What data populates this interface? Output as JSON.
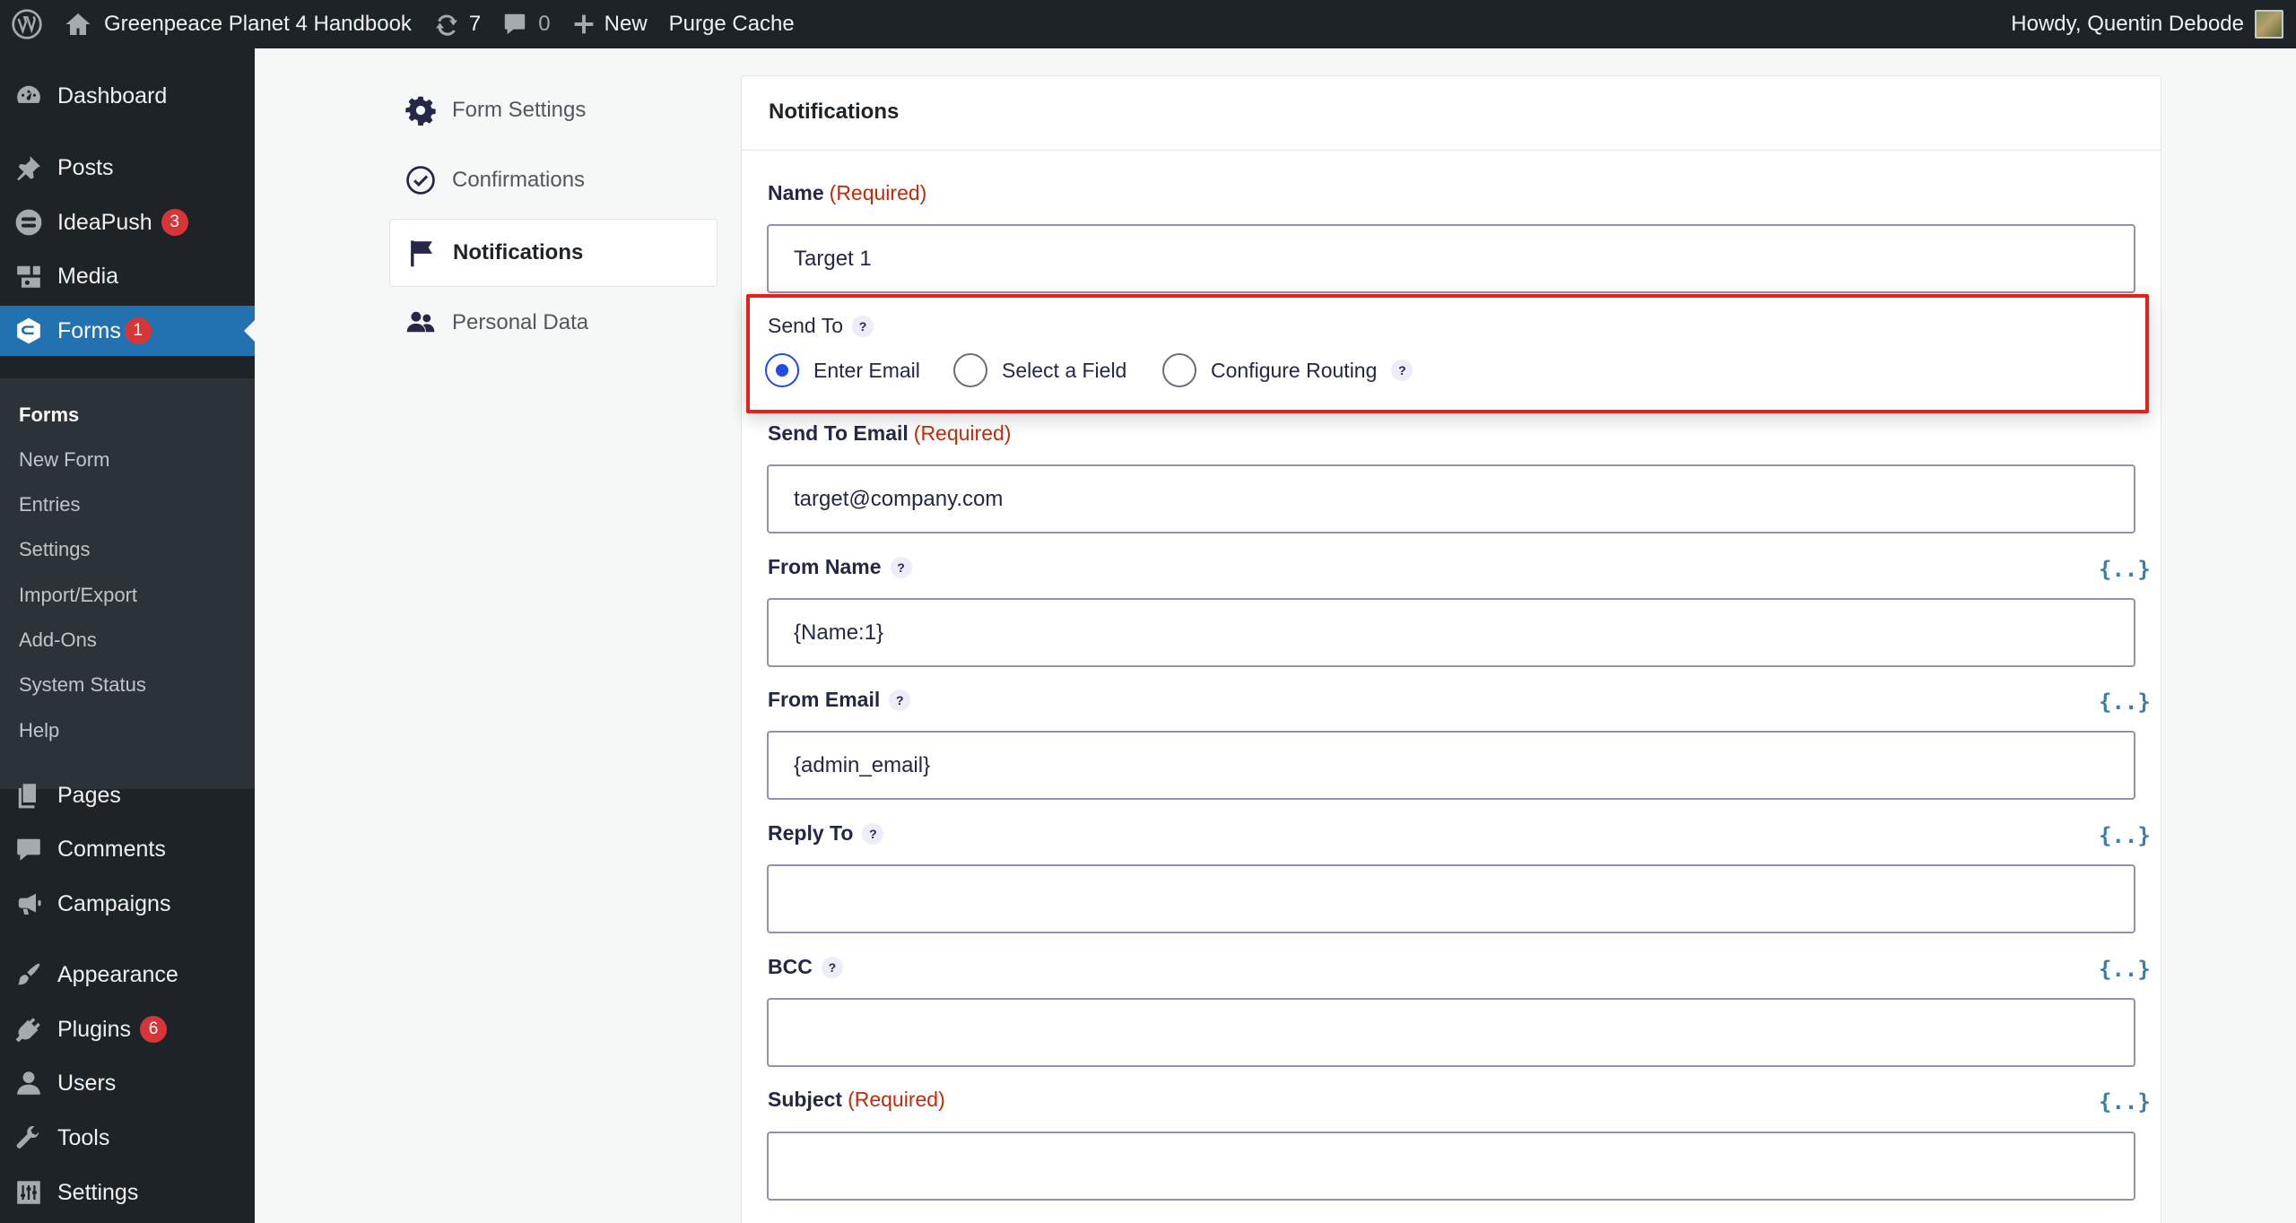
{
  "adminbar": {
    "site_name": "Greenpeace Planet 4 Handbook",
    "updates_count": "7",
    "comments_count": "0",
    "new_label": "New",
    "purge_label": "Purge Cache",
    "greeting": "Howdy, Quentin Debode"
  },
  "sidebar": {
    "items": {
      "dashboard": "Dashboard",
      "posts": "Posts",
      "ideapush": "IdeaPush",
      "ideapush_badge": "3",
      "media": "Media",
      "forms": "Forms",
      "forms_badge": "1",
      "pages": "Pages",
      "comments": "Comments",
      "campaigns": "Campaigns",
      "appearance": "Appearance",
      "plugins": "Plugins",
      "plugins_badge": "6",
      "users": "Users",
      "tools": "Tools",
      "settings": "Settings"
    },
    "submenu": [
      "Forms",
      "New Form",
      "Entries",
      "Settings",
      "Import/Export",
      "Add-Ons",
      "System Status",
      "Help"
    ]
  },
  "settings_nav": {
    "form_settings": "Form Settings",
    "confirmations": "Confirmations",
    "notifications": "Notifications",
    "personal_data": "Personal Data"
  },
  "panel": {
    "title": "Notifications",
    "required": "(Required)",
    "help": "?",
    "merge_tag": "{..}",
    "name": {
      "label": "Name",
      "value": "Target 1"
    },
    "send_to": {
      "label": "Send To",
      "options": [
        "Enter Email",
        "Select a Field",
        "Configure Routing"
      ],
      "selected": "Enter Email"
    },
    "send_to_email": {
      "label": "Send To Email",
      "value": "target@company.com"
    },
    "from_name": {
      "label": "From Name",
      "value": "{Name:1}"
    },
    "from_email": {
      "label": "From Email",
      "value": "{admin_email}"
    },
    "reply_to": {
      "label": "Reply To",
      "value": ""
    },
    "bcc": {
      "label": "BCC",
      "value": ""
    },
    "subject": {
      "label": "Subject",
      "value": ""
    }
  },
  "colors": {
    "adminbar_bg": "#1d2327",
    "menu_active": "#2271b1",
    "badge": "#d63638",
    "required": "#c02b0a",
    "highlight_border": "#e3201b",
    "radio_selected": "#204ce5"
  }
}
